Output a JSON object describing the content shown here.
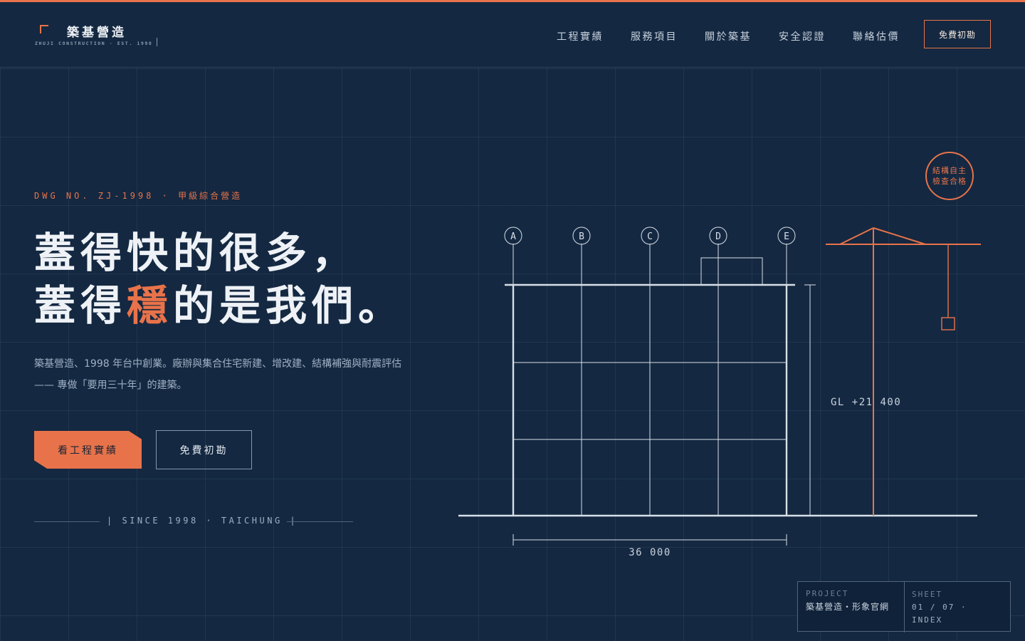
{
  "brand": {
    "name": "築基營造",
    "tagline": "ZHUJI CONSTRUCTION · EST. 1998"
  },
  "nav": {
    "items": [
      "工程實績",
      "服務項目",
      "關於築基",
      "安全認證",
      "聯絡估價"
    ],
    "cta": "免費初勘"
  },
  "hero": {
    "dwg_code": "DWG NO. ZJ-1998 ·",
    "dwg_grade": "甲級綜合營造",
    "headline_line1": "蓋得快的很多，",
    "headline_line2_pre": "蓋得",
    "headline_line2_accent": "穩",
    "headline_line2_post": "的是我們。",
    "lede": "築基營造、1998 年台中創業。廠辦與集合住宅新建、增改建、結構補強與耐震評估—— 專做「要用三十年」的建築。",
    "primary_button": "看工程實績",
    "secondary_button": "免費初勘",
    "since": "| SINCE 1998 · TAICHUNG |"
  },
  "drawing": {
    "grid_labels": [
      "A",
      "B",
      "C",
      "D",
      "E"
    ],
    "level_label": "GL +21 400",
    "width_label": "36 000",
    "stamp_line1": "結構自主",
    "stamp_line2": "檢查合格"
  },
  "title_block": {
    "project_label": "PROJECT",
    "project_value": "築基營造・形象官網",
    "sheet_label": "SHEET",
    "sheet_value": "01 / 07 ·",
    "sheet_name": "INDEX"
  },
  "colors": {
    "background": "#142841",
    "accent": "#e8734a",
    "text": "#eef2f6",
    "muted": "#9fb0c4"
  }
}
